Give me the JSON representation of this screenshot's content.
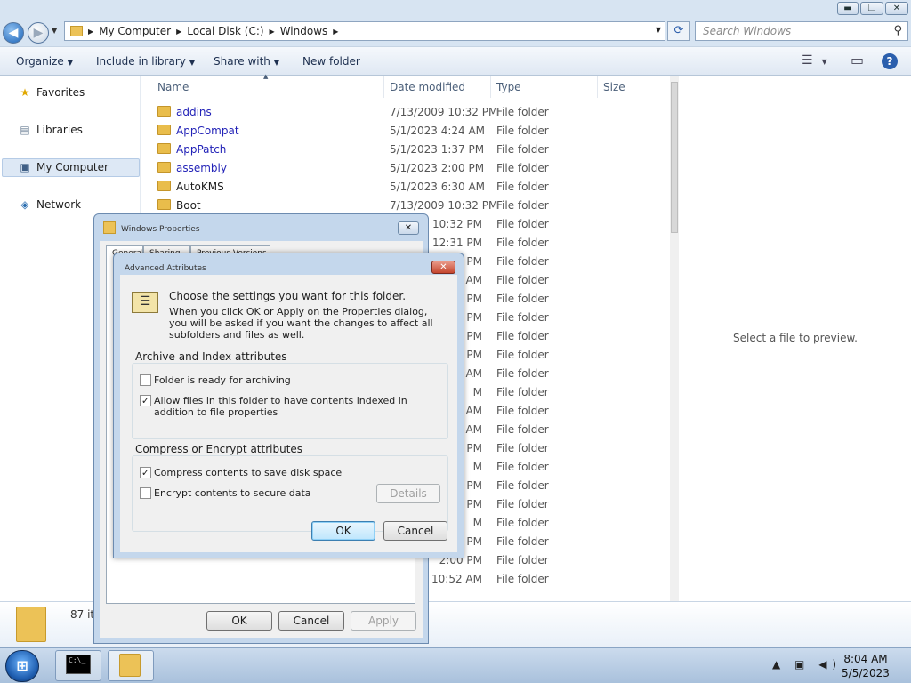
{
  "window": {
    "caption_buttons": {
      "minimize": "▬",
      "maximize": "❐",
      "close": "✕"
    }
  },
  "nav": {
    "back_glyph": "◀",
    "forward_glyph": "▶",
    "recent_glyph": "▼",
    "address_parts": [
      "My Computer",
      "Local Disk (C:)",
      "Windows"
    ],
    "separator_glyph": "▶",
    "dropdown_glyph": "▼",
    "refresh_glyph": "⟳",
    "search_placeholder": "Search Windows",
    "search_glyph": "⚲"
  },
  "toolbar": {
    "items": [
      "Organize",
      "Include in library",
      "Share with",
      "New folder"
    ],
    "caret": "▼",
    "view_glyph": "☰",
    "pane_glyph": "▭",
    "help_glyph": "?"
  },
  "navpane": {
    "items": [
      {
        "label": "Favorites",
        "icon": "star-icon",
        "glyph": "★"
      },
      {
        "label": "Libraries",
        "icon": "libraries-icon",
        "glyph": "▤"
      },
      {
        "label": "My Computer",
        "icon": "computer-icon",
        "glyph": "▣"
      },
      {
        "label": "Network",
        "icon": "network-icon",
        "glyph": "◈"
      }
    ]
  },
  "filelist": {
    "columns": [
      "Name",
      "Date modified",
      "Type",
      "Size"
    ],
    "sort_glyph": "▲",
    "rows": [
      {
        "name": "addins",
        "date": "7/13/2009 10:32 PM",
        "type": "File folder",
        "blue": true
      },
      {
        "name": "AppCompat",
        "date": "5/1/2023 4:24 AM",
        "type": "File folder",
        "blue": true
      },
      {
        "name": "AppPatch",
        "date": "5/1/2023 1:37 PM",
        "type": "File folder",
        "blue": true
      },
      {
        "name": "assembly",
        "date": "5/1/2023 2:00 PM",
        "type": "File folder",
        "blue": true
      },
      {
        "name": "AutoKMS",
        "date": "5/1/2023 6:30 AM",
        "type": "File folder",
        "blue": false
      },
      {
        "name": "Boot",
        "date": "7/13/2009 10:32 PM",
        "type": "File folder",
        "blue": false
      },
      {
        "name": "",
        "date": "9 10:32 PM",
        "type": "File folder"
      },
      {
        "name": "",
        "date": "23 12:31 PM",
        "type": "File folder"
      },
      {
        "name": "",
        "date": "PM",
        "type": "File folder"
      },
      {
        "name": "",
        "date": "AM",
        "type": "File folder"
      },
      {
        "name": "",
        "date": "PM",
        "type": "File folder"
      },
      {
        "name": "",
        "date": "PM",
        "type": "File folder"
      },
      {
        "name": "",
        "date": "PM",
        "type": "File folder"
      },
      {
        "name": "",
        "date": "PM",
        "type": "File folder"
      },
      {
        "name": "",
        "date": "AM",
        "type": "File folder"
      },
      {
        "name": "",
        "date": "M",
        "type": "File folder"
      },
      {
        "name": "",
        "date": "AM",
        "type": "File folder"
      },
      {
        "name": "",
        "date": "AM",
        "type": "File folder"
      },
      {
        "name": "",
        "date": "PM",
        "type": "File folder"
      },
      {
        "name": "",
        "date": "M",
        "type": "File folder"
      },
      {
        "name": "",
        "date": "PM",
        "type": "File folder"
      },
      {
        "name": "",
        "date": "PM",
        "type": "File folder"
      },
      {
        "name": "",
        "date": "M",
        "type": "File folder"
      },
      {
        "name": "",
        "date": "PM",
        "type": "File folder"
      },
      {
        "name": "",
        "date": "2:00 PM",
        "type": "File folder"
      },
      {
        "name": "",
        "date": "23 10:52 AM",
        "type": "File folder"
      }
    ]
  },
  "preview": {
    "text": "Select a file to preview."
  },
  "details": {
    "count": "87 it"
  },
  "taskbar": {
    "start_glyph": "⊞",
    "cmd_text": "C:\\_",
    "tray_glyphs": "▲ ▣ ◀)",
    "time": "8:04 AM",
    "date": "5/5/2023"
  },
  "props": {
    "title": "Windows Properties",
    "close_glyph": "✕",
    "tabs": [
      "General",
      "Sharing",
      "Previous Versions"
    ],
    "ok": "OK",
    "cancel": "Cancel",
    "apply": "Apply"
  },
  "adv": {
    "title": "Advanced Attributes",
    "close_glyph": "✕",
    "icon_glyph": "☰",
    "intro1": "Choose the settings you want for this folder.",
    "intro2": "When you click OK or Apply on the Properties dialog, you will be asked if you want the changes to affect all subfolders and files as well.",
    "group1_title": "Archive and Index attributes",
    "group2_title": "Compress or Encrypt attributes",
    "check_glyph": "✓",
    "options": {
      "archive": {
        "label": "Folder is ready for archiving",
        "checked": false
      },
      "index": {
        "label": "Allow files in this folder to have contents indexed in addition to file properties",
        "checked": true
      },
      "compress": {
        "label": "Compress contents to save disk space",
        "checked": true
      },
      "encrypt": {
        "label": "Encrypt contents to secure data",
        "checked": false
      }
    },
    "details": "Details",
    "ok": "OK",
    "cancel": "Cancel"
  }
}
